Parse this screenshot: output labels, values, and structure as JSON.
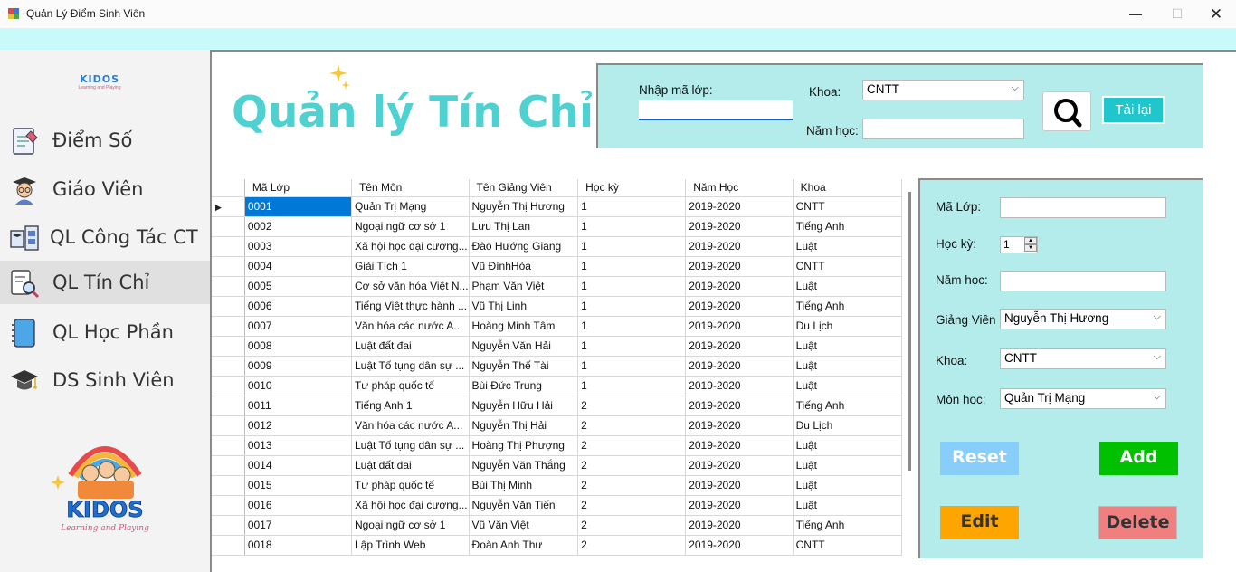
{
  "window": {
    "title": "Quản Lý Điểm Sinh Viên",
    "min": "—",
    "max": "☐",
    "close": "✕"
  },
  "sidebar": {
    "logo": "KIDOS",
    "logo_sub": "Learning and Playing",
    "items": [
      {
        "label": "Điểm Số",
        "icon": "grade-sheet-icon"
      },
      {
        "label": "Giáo Viên",
        "icon": "teacher-icon"
      },
      {
        "label": "QL Công Tác CT",
        "icon": "work-board-icon"
      },
      {
        "label": "QL Tín Chỉ",
        "icon": "search-document-icon",
        "active": true
      },
      {
        "label": "QL Học Phần",
        "icon": "notebook-icon"
      },
      {
        "label": "DS Sinh Viên",
        "icon": "graduation-cap-icon"
      }
    ],
    "mascot_brand": "KIDOS",
    "mascot_tagline": "Learning and Playing"
  },
  "page": {
    "title": "Quản lý Tín Chỉ"
  },
  "search": {
    "class_label": "Nhập mã lớp:",
    "class_value": "",
    "faculty_label": "Khoa:",
    "faculty_value": "CNTT",
    "year_label": "Năm học:",
    "year_value": "",
    "reload_label": "Tải lại"
  },
  "grid": {
    "columns": [
      "Mã Lớp",
      "Tên Môn",
      "Tên Giảng Viên",
      "Học kỳ",
      "Năm Học",
      "Khoa"
    ],
    "rows": [
      [
        "0001",
        "Quản Trị Mạng",
        "Nguyễn Thị Hương",
        "1",
        "2019-2020",
        "CNTT"
      ],
      [
        "0002",
        "Ngoại ngữ cơ sở 1",
        "Lưu Thị Lan",
        "1",
        "2019-2020",
        "Tiếng Anh"
      ],
      [
        "0003",
        "Xã hội học đại cương...",
        "Đào Hướng Giang",
        "1",
        "2019-2020",
        "Luật"
      ],
      [
        "0004",
        "Giải Tích 1",
        "Vũ ĐìnhHòa",
        "1",
        "2019-2020",
        "CNTT"
      ],
      [
        "0005",
        "Cơ sở văn hóa Việt N...",
        "Phạm Văn Việt",
        "1",
        "2019-2020",
        "Luật"
      ],
      [
        "0006",
        "Tiếng Việt thực hành ...",
        "Vũ Thị Linh",
        "1",
        "2019-2020",
        "Tiếng Anh"
      ],
      [
        "0007",
        "Văn hóa các nước A...",
        "Hoàng Minh Tâm",
        "1",
        "2019-2020",
        "Du Lịch"
      ],
      [
        "0008",
        "Luật đất đai",
        "Nguyễn Văn Hải",
        "1",
        "2019-2020",
        "Luật"
      ],
      [
        "0009",
        "Luật Tố tụng dân sự ...",
        "Nguyễn Thế Tài",
        "1",
        "2019-2020",
        "Luật"
      ],
      [
        "0010",
        "Tư pháp quốc tế",
        "Bùi Đức Trung",
        "1",
        "2019-2020",
        "Luật"
      ],
      [
        "0011",
        "Tiếng Anh 1",
        "Nguyễn Hữu Hải",
        "2",
        "2019-2020",
        "Tiếng Anh"
      ],
      [
        "0012",
        "Văn hóa các nước A...",
        "Nguyễn Thị Hải",
        "2",
        "2019-2020",
        "Du Lịch"
      ],
      [
        "0013",
        "Luật Tố tụng dân sự ...",
        "Hoàng Thị Phượng",
        "2",
        "2019-2020",
        "Luật"
      ],
      [
        "0014",
        "Luật đất đai",
        "Nguyễn Văn Thắng",
        "2",
        "2019-2020",
        "Luật"
      ],
      [
        "0015",
        "Tư pháp quốc tế",
        "Bùi Thị Minh",
        "2",
        "2019-2020",
        "Luật"
      ],
      [
        "0016",
        "Xã hội học đại cương...",
        "Nguyễn Văn Tiến",
        "2",
        "2019-2020",
        "Luật"
      ],
      [
        "0017",
        "Ngoại ngữ cơ sở 1",
        "Vũ Văn Việt",
        "2",
        "2019-2020",
        "Tiếng Anh"
      ],
      [
        "0018",
        "Lập Trình Web",
        "Đoàn Anh Thư",
        "2",
        "2019-2020",
        "CNTT"
      ]
    ]
  },
  "detail": {
    "class_label": "Mã Lớp:",
    "class_value": "",
    "semester_label": "Học kỳ:",
    "semester_value": "1",
    "year_label": "Năm học:",
    "year_value": "",
    "lecturer_label": "Giảng Viên",
    "lecturer_value": "Nguyễn Thị Hương",
    "faculty_label": "Khoa:",
    "faculty_value": "CNTT",
    "subject_label": "Môn học:",
    "subject_value": "Quản Trị Mạng",
    "reset_label": "Reset",
    "add_label": "Add",
    "edit_label": "Edit",
    "delete_label": "Delete"
  },
  "colors": {
    "title_cyan": "#4fd1d1",
    "panel_bg": "#b4ecec",
    "reload_btn": "#21c5cc",
    "selection": "#0078d7",
    "reset": "#87cefa",
    "add": "#00c000",
    "edit": "#ffa500",
    "delete": "#f08080"
  }
}
